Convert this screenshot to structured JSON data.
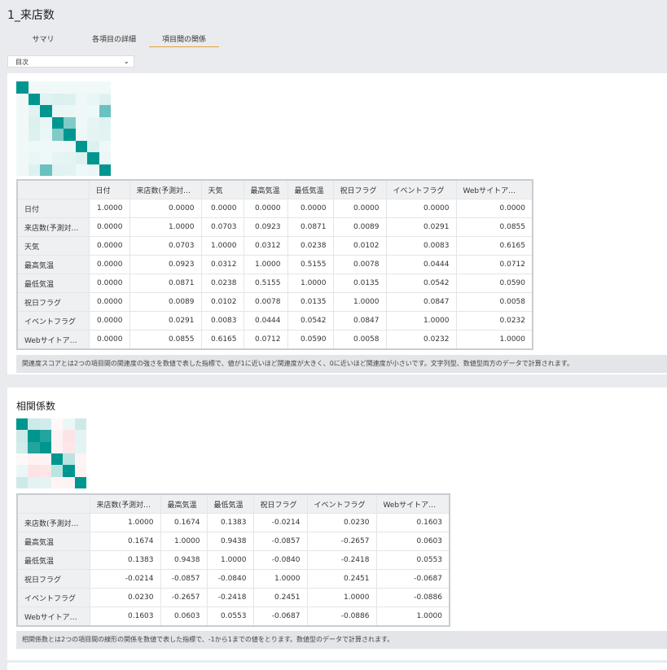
{
  "page": {
    "title": "1_来店数"
  },
  "tabs": [
    {
      "label": "サマリ",
      "active": false
    },
    {
      "label": "各項目の詳細",
      "active": false
    },
    {
      "label": "項目間の関係",
      "active": true
    }
  ],
  "toc": {
    "value": "目次"
  },
  "association": {
    "columns": [
      "日付",
      "来店数(予測対…",
      "天気",
      "最高気温",
      "最低気温",
      "祝日フラグ",
      "イベントフラグ",
      "Webサイトア…"
    ],
    "rows": [
      {
        "label": "日付",
        "values": [
          "1.0000",
          "0.0000",
          "0.0000",
          "0.0000",
          "0.0000",
          "0.0000",
          "0.0000",
          "0.0000"
        ]
      },
      {
        "label": "来店数(予測対…",
        "values": [
          "0.0000",
          "1.0000",
          "0.0703",
          "0.0923",
          "0.0871",
          "0.0089",
          "0.0291",
          "0.0855"
        ]
      },
      {
        "label": "天気",
        "values": [
          "0.0000",
          "0.0703",
          "1.0000",
          "0.0312",
          "0.0238",
          "0.0102",
          "0.0083",
          "0.6165"
        ]
      },
      {
        "label": "最高気温",
        "values": [
          "0.0000",
          "0.0923",
          "0.0312",
          "1.0000",
          "0.5155",
          "0.0078",
          "0.0444",
          "0.0712"
        ]
      },
      {
        "label": "最低気温",
        "values": [
          "0.0000",
          "0.0871",
          "0.0238",
          "0.5155",
          "1.0000",
          "0.0135",
          "0.0542",
          "0.0590"
        ]
      },
      {
        "label": "祝日フラグ",
        "values": [
          "0.0000",
          "0.0089",
          "0.0102",
          "0.0078",
          "0.0135",
          "1.0000",
          "0.0847",
          "0.0058"
        ]
      },
      {
        "label": "イベントフラグ",
        "values": [
          "0.0000",
          "0.0291",
          "0.0083",
          "0.0444",
          "0.0542",
          "0.0847",
          "1.0000",
          "0.0232"
        ]
      },
      {
        "label": "Webサイトア…",
        "values": [
          "0.0000",
          "0.0855",
          "0.6165",
          "0.0712",
          "0.0590",
          "0.0058",
          "0.0232",
          "1.0000"
        ]
      }
    ],
    "note": "関連度スコアとは2つの項目間の関連度の強さを数値で表した指標で、値が1に近いほど関連度が大きく、0に近いほど関連度が小さいです。文字列型、数値型両方のデータで計算されます。"
  },
  "correlation": {
    "title": "相関係数",
    "columns": [
      "来店数(予測対…",
      "最高気温",
      "最低気温",
      "祝日フラグ",
      "イベントフラグ",
      "Webサイトア…"
    ],
    "rows": [
      {
        "label": "来店数(予測対…",
        "values": [
          "1.0000",
          "0.1674",
          "0.1383",
          "-0.0214",
          "0.0230",
          "0.1603"
        ]
      },
      {
        "label": "最高気温",
        "values": [
          "0.1674",
          "1.0000",
          "0.9438",
          "-0.0857",
          "-0.2657",
          "0.0603"
        ]
      },
      {
        "label": "最低気温",
        "values": [
          "0.1383",
          "0.9438",
          "1.0000",
          "-0.0840",
          "-0.2418",
          "0.0553"
        ]
      },
      {
        "label": "祝日フラグ",
        "values": [
          "-0.0214",
          "-0.0857",
          "-0.0840",
          "1.0000",
          "0.2451",
          "-0.0687"
        ]
      },
      {
        "label": "イベントフラグ",
        "values": [
          "0.0230",
          "-0.2657",
          "-0.2418",
          "0.2451",
          "1.0000",
          "-0.0886"
        ]
      },
      {
        "label": "Webサイトア…",
        "values": [
          "0.1603",
          "0.0603",
          "0.0553",
          "-0.0687",
          "-0.0886",
          "1.0000"
        ]
      }
    ],
    "note": "相関係数とは2つの項目間の線形の関係を数値で表した指標で、-1から1までの値をとります。数値型のデータで計算されます。"
  },
  "colors": {
    "positive": "#009690",
    "negative": "#f4a0a8",
    "accent": "#e3a33a"
  }
}
